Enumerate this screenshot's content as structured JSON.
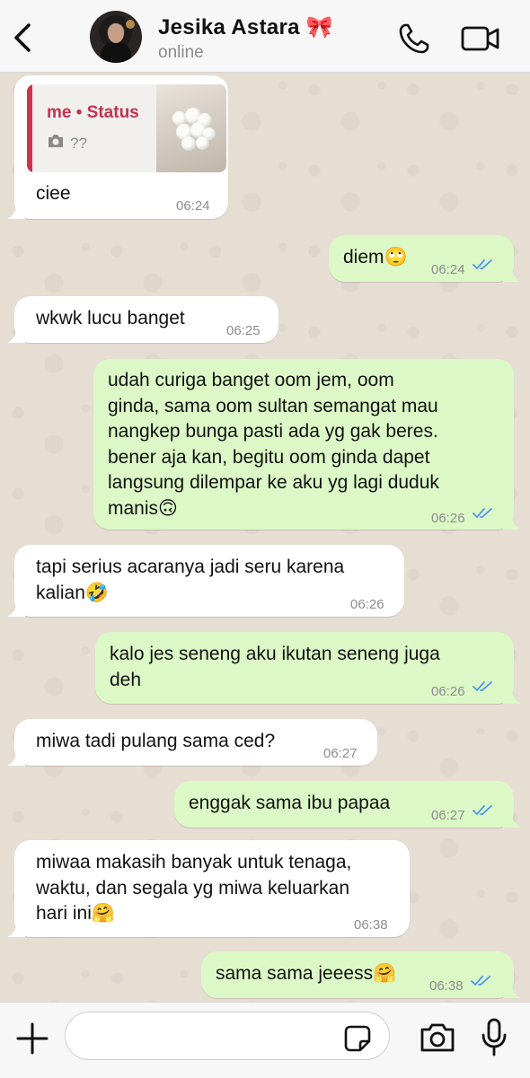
{
  "header": {
    "contact_name": "Jesika Astara 🎀",
    "status": "online"
  },
  "reply_quote": {
    "title": "me • Status",
    "subtitle": "??"
  },
  "messages": [
    {
      "dir": "in",
      "text": "ciee",
      "time": "06:24"
    },
    {
      "dir": "out",
      "text": "diem🙄",
      "time": "06:24"
    },
    {
      "dir": "in",
      "text": "wkwk lucu banget",
      "time": "06:25"
    },
    {
      "dir": "out",
      "text": "udah curiga banget oom jem, oom\nginda, sama oom sultan semangat mau\nnangkep bunga pasti ada yg gak beres.\nbener aja kan, begitu oom ginda dapet\nlangsung dilempar ke aku yg lagi duduk\nmanis🙃",
      "time": "06:26"
    },
    {
      "dir": "in",
      "text": "tapi serius acaranya jadi seru karena\nkalian🤣",
      "time": "06:26"
    },
    {
      "dir": "out",
      "text": "kalo jes seneng aku ikutan seneng juga\ndeh",
      "time": "06:26"
    },
    {
      "dir": "in",
      "text": "miwa tadi pulang sama ced?",
      "time": "06:27"
    },
    {
      "dir": "out",
      "text": "enggak sama ibu papaa",
      "time": "06:27"
    },
    {
      "dir": "in",
      "text": "miwaa makasih banyak untuk tenaga,\nwaktu, dan segala yg miwa keluarkan\nhari ini🤗",
      "time": "06:38"
    },
    {
      "dir": "out",
      "text": "sama sama jeeess🤗",
      "time": "06:38"
    }
  ],
  "input": {
    "placeholder": ""
  },
  "colors": {
    "incoming_bubble": "#ffffff",
    "outgoing_bubble": "#dcf8c6",
    "read_ticks": "#4f95f0",
    "quote_accent": "#c4304c"
  }
}
